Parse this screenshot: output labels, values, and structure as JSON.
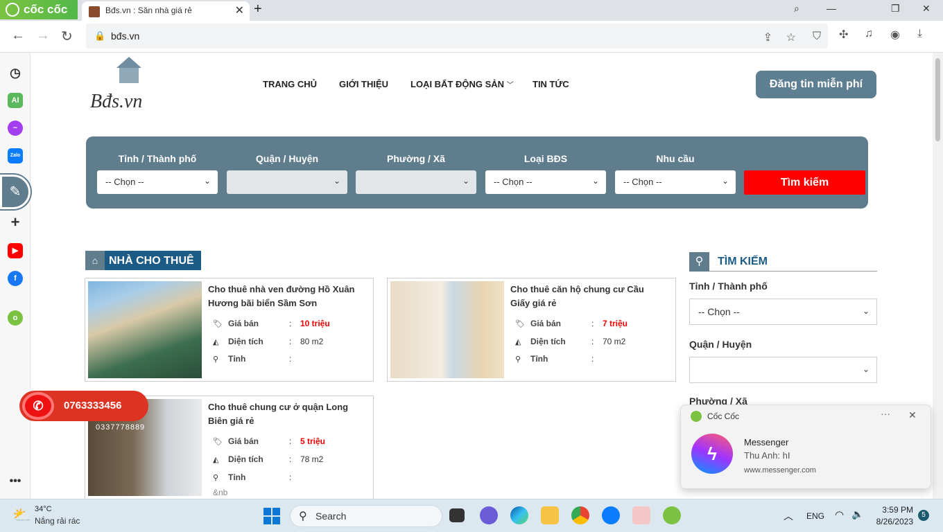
{
  "browser": {
    "brand": "cốc cốc",
    "tab_title": "Bđs.vn : Săn nhà giá rẻ",
    "url": "bđs.vn"
  },
  "site": {
    "logo": "Bđs.vn",
    "menu": [
      "TRANG CHỦ",
      "GIỚI THIỆU",
      "LOẠI BẤT ĐỘNG SẢN",
      "TIN TỨC"
    ],
    "post_button": "Đăng tin miễn phí"
  },
  "search": {
    "labels": [
      "Tỉnh / Thành phố",
      "Quận / Huyện",
      "Phường / Xã",
      "Loại BĐS",
      "Nhu cầu"
    ],
    "values": [
      "-- Chọn --",
      "",
      "",
      "-- Chọn --",
      "-- Chọn --"
    ],
    "button": "Tìm kiếm"
  },
  "section": {
    "title": "NHÀ CHO THUÊ"
  },
  "field_labels": {
    "price": "Giá bán",
    "area": "Diện tích",
    "province": "Tỉnh",
    "colon": ":"
  },
  "listings": [
    {
      "title": "Cho thuê nhà ven đường Hồ Xuân Hương bãi biển Sầm Sơn",
      "price": "10 triệu",
      "area": "80 m2",
      "province": ""
    },
    {
      "title": "Cho thuê căn hộ chung cư Cầu Giấy giá rẻ",
      "price": "7 triệu",
      "area": "70 m2",
      "province": ""
    },
    {
      "title": "Cho thuê chung cư ở quận Long Biên giá rẻ",
      "price": "5 triệu",
      "area": "78 m2",
      "province": "",
      "extra": "&nb"
    }
  ],
  "sidebar_search": {
    "title": "TÌM KIẾM",
    "fields": [
      {
        "label": "Tỉnh / Thành phố",
        "value": "-- Chọn --"
      },
      {
        "label": "Quận / Huyện",
        "value": ""
      },
      {
        "label": "Phường / Xã"
      }
    ]
  },
  "hotline": {
    "main": "0763333456",
    "secondary": "0337778889"
  },
  "notification": {
    "app": "Cốc Cốc",
    "title": "Messenger",
    "message": "Thu Anh: hI",
    "source": "www.messenger.com"
  },
  "taskbar": {
    "weather_temp": "34°C",
    "weather_desc": "Nắng rải rác",
    "search": "Search",
    "lang": "ENG",
    "time": "3:59 PM",
    "date": "8/26/2023",
    "badge": "5"
  },
  "colors": {
    "brand": "#5f7d8d",
    "accent": "#ff0000",
    "heading": "#1c5b86"
  }
}
